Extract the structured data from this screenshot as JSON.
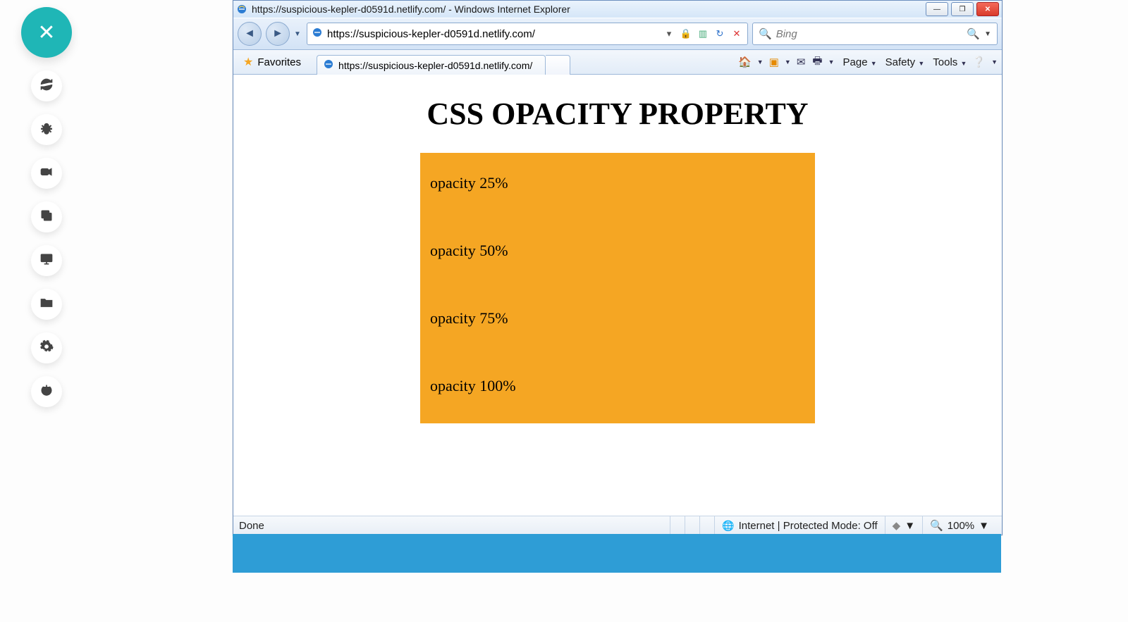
{
  "sidebar": {
    "close_label": "✕",
    "items": [
      "refresh",
      "bug",
      "video",
      "copy",
      "desktop",
      "folder",
      "gear",
      "power"
    ]
  },
  "window": {
    "title": "https://suspicious-kepler-d0591d.netlify.com/ - Windows Internet Explorer",
    "min": "—",
    "max": "❐",
    "close": "✕"
  },
  "nav": {
    "url": "https://suspicious-kepler-d0591d.netlify.com/",
    "search_placeholder": "Bing"
  },
  "favrow": {
    "favorites_label": "Favorites",
    "tab_title": "https://suspicious-kepler-d0591d.netlify.com/",
    "cmd": {
      "page": "Page",
      "safety": "Safety",
      "tools": "Tools"
    }
  },
  "page": {
    "heading": "CSS OPACITY PROPERTY",
    "lines": [
      "opacity 25%",
      "opacity 50%",
      "opacity 75%",
      "opacity 100%"
    ]
  },
  "status": {
    "done": "Done",
    "zone": "Internet | Protected Mode: Off",
    "zoom": "100%"
  }
}
